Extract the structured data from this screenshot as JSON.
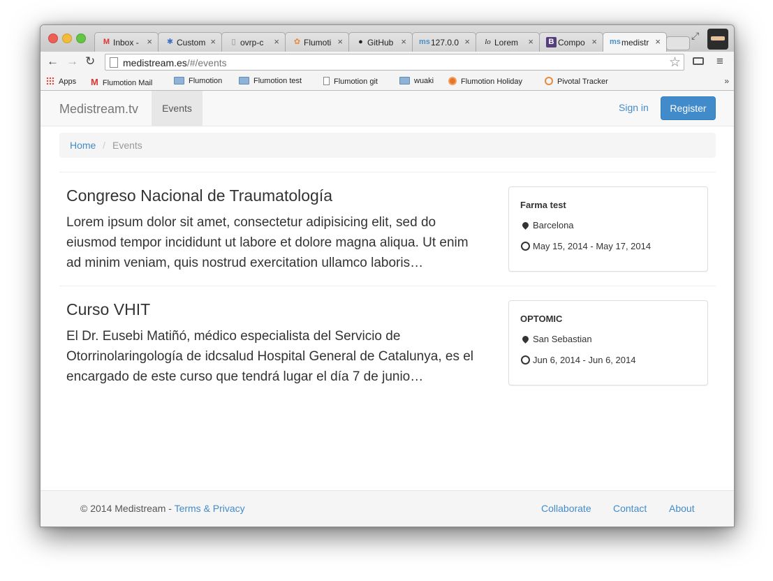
{
  "browser": {
    "tabs": [
      {
        "label": "Inbox -",
        "icon": "gmail-icon"
      },
      {
        "label": "Custom",
        "icon": "paw-icon"
      },
      {
        "label": "ovrp-c",
        "icon": "page-icon"
      },
      {
        "label": "Flumoti",
        "icon": "flumotion-icon"
      },
      {
        "label": "GitHub",
        "icon": "github-icon"
      },
      {
        "label": "127.0.0",
        "icon": "medistream-icon"
      },
      {
        "label": "Lorem",
        "icon": "lorem-icon"
      },
      {
        "label": "Compo",
        "icon": "bootstrap-icon"
      },
      {
        "label": "medistr",
        "icon": "medistream-icon",
        "active": true
      }
    ],
    "url": {
      "host": "medistream.es",
      "path": "/#/events"
    },
    "bookmarks": [
      {
        "label": "Apps",
        "icon": "apps-icon"
      },
      {
        "label": "Flumotion Mail",
        "icon": "gmail-icon"
      },
      {
        "label": "Flumotion",
        "icon": "folder-icon"
      },
      {
        "label": "Flumotion test",
        "icon": "folder-icon"
      },
      {
        "label": "Flumotion git",
        "icon": "page-icon"
      },
      {
        "label": "wuaki",
        "icon": "folder-icon"
      },
      {
        "label": "Flumotion Holiday",
        "icon": "holiday-icon"
      },
      {
        "label": "Pivotal Tracker",
        "icon": "pivotal-icon"
      }
    ],
    "bookmarks_more": "»"
  },
  "navbar": {
    "brand": "Medistream.tv",
    "active_item": "Events",
    "signin": "Sign in",
    "register": "Register"
  },
  "breadcrumb": {
    "home": "Home",
    "separator": "/",
    "current": "Events"
  },
  "events": [
    {
      "title": "Congreso Nacional de Traumatología",
      "description": "Lorem ipsum dolor sit amet, consectetur adipisicing elit, sed do eiusmod tempor incididunt ut labore et dolore magna aliqua. Ut enim ad minim veniam, quis nostrud exercitation ullamco laboris…",
      "organizer": "Farma test",
      "location": "Barcelona",
      "dates": "May 15, 2014 - May 17, 2014"
    },
    {
      "title": "Curso VHIT",
      "description": "El Dr. Eusebi Matiñó, médico especialista del Servicio de Otorrinolaringología de idcsalud Hospital General de Catalunya, es el encargado de este curso que tendrá lugar el día 7 de junio…",
      "organizer": "OPTOMIC",
      "location": "San Sebastian",
      "dates": "Jun 6, 2014 - Jun 6, 2014"
    }
  ],
  "footer": {
    "copyright": "© 2014 Medistream - ",
    "terms": "Terms & Privacy",
    "links": [
      "Collaborate",
      "Contact",
      "About"
    ]
  },
  "colors": {
    "link": "#428bca",
    "register_button": "#428bca",
    "navbar_bg": "#f8f8f8"
  }
}
